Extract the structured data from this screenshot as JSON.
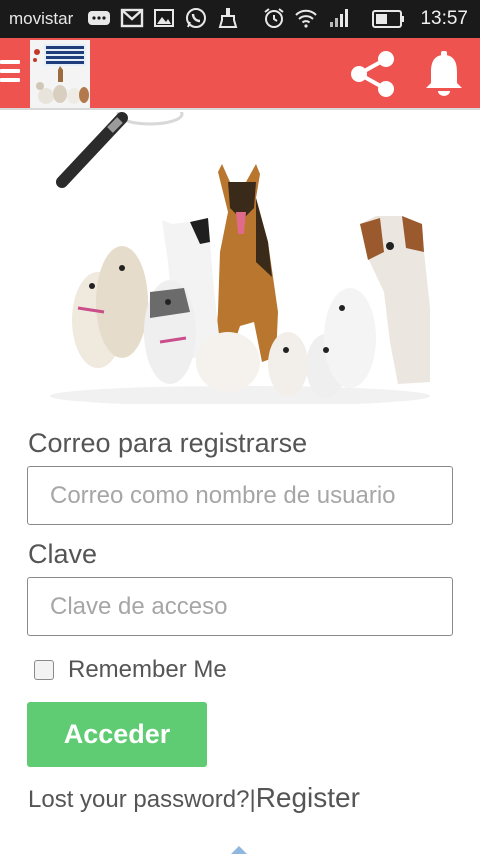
{
  "status_bar": {
    "carrier": "movistar",
    "time": "13:57",
    "icons": [
      "chat-icon",
      "gmail-icon",
      "gallery-icon",
      "whatsapp-icon",
      "cleaner-icon",
      "alarm-icon",
      "wifi-icon",
      "signal-icon",
      "battery-icon"
    ]
  },
  "header": {
    "color": "#ef5350",
    "menu_icon": "hamburger-icon",
    "logo_text": "PROTECTORA DE ANIMALES",
    "actions": [
      "share-icon",
      "bell-icon"
    ]
  },
  "form": {
    "email_label": "Correo para registrarse",
    "email_placeholder": "Correo como nombre de usuario",
    "password_label": "Clave",
    "password_placeholder": "Clave de acceso",
    "remember_label": "Remember Me",
    "remember_checked": false,
    "submit_label": "Acceder",
    "submit_color": "#5fcb72",
    "lost_password_label": "Lost your password?",
    "separator": "|",
    "register_label": "Register"
  }
}
